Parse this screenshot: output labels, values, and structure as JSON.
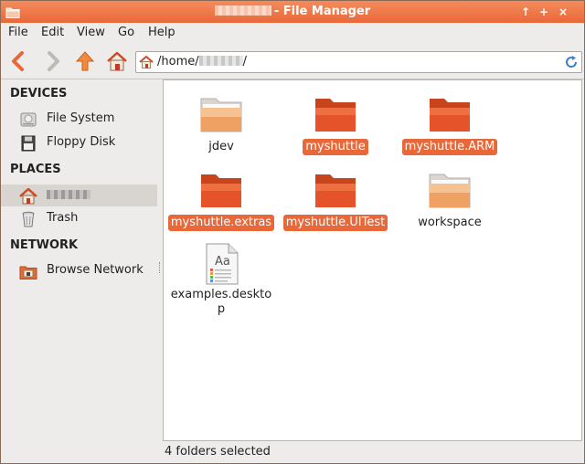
{
  "window": {
    "title_suffix": "- File Manager",
    "controls": {
      "up": "↑",
      "maximize": "+",
      "close": "×"
    }
  },
  "menubar": {
    "items": [
      "File",
      "Edit",
      "View",
      "Go",
      "Help"
    ]
  },
  "toolbar": {
    "back_icon": "chevron-left-icon",
    "forward_icon": "chevron-right-icon",
    "up_icon": "arrow-up-icon",
    "home_icon": "home-icon",
    "location_prefix": "/home/",
    "location_suffix": "/"
  },
  "sidebar": {
    "sections": {
      "devices": "DEVICES",
      "places": "PLACES",
      "network": "NETWORK"
    },
    "devices": [
      {
        "label": "File System",
        "icon": "hard-drive-icon"
      },
      {
        "label": "Floppy Disk",
        "icon": "floppy-disk-icon"
      }
    ],
    "places": [
      {
        "label": "",
        "icon": "home-folder-icon",
        "selected": true
      },
      {
        "label": "Trash",
        "icon": "trash-icon"
      }
    ],
    "network": [
      {
        "label": "Browse Network",
        "icon": "network-icon"
      }
    ]
  },
  "files": [
    {
      "name": "jdev",
      "type": "folder",
      "selected": false
    },
    {
      "name": "myshuttle",
      "type": "folder",
      "selected": true
    },
    {
      "name": "myshuttle.ARM",
      "type": "folder",
      "selected": true
    },
    {
      "name": "myshuttle.extras",
      "type": "folder",
      "selected": true
    },
    {
      "name": "myshuttle.UITest",
      "type": "folder",
      "selected": true
    },
    {
      "name": "workspace",
      "type": "folder",
      "selected": false
    },
    {
      "name_line1": "examples.deskto",
      "name_line2": "p",
      "type": "desktop-file",
      "selected": false
    }
  ],
  "status": {
    "text": "4 folders selected"
  },
  "colors": {
    "accent": "#e8683a",
    "titlebar": "#f07a4a",
    "folder": "#e4532a"
  }
}
